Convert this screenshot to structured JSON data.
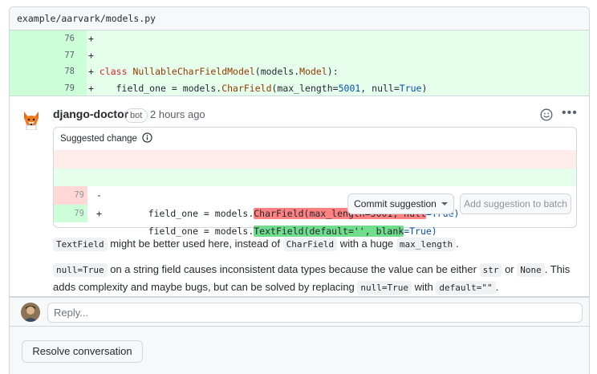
{
  "file": {
    "path": "example/aarvark/models.py"
  },
  "diff": {
    "lines": [
      {
        "num": "76",
        "sign": "+",
        "code": ""
      },
      {
        "num": "77",
        "sign": "+",
        "code": ""
      },
      {
        "num": "78",
        "sign": "+",
        "kw": "class",
        "cls_name": "NullableCharFieldModel",
        "paren_open": "(models.",
        "base": "Model",
        "paren_close": "):"
      },
      {
        "num": "79",
        "sign": "+",
        "pre": "    field_one = models.",
        "field_class": "CharField",
        "args_a": "(max_length=",
        "n": "5001",
        "args_b": ", null=",
        "val": "True",
        "close": ")"
      }
    ]
  },
  "comment": {
    "author": "django-doctor",
    "badge": "bot",
    "time": "2 hours ago",
    "suggestion": {
      "header": "Suggested change",
      "del": {
        "num": "79",
        "sign": "-",
        "pre": "    field_one = models.",
        "hl": "CharField(max_length=5001, null",
        "post": "=True)"
      },
      "add": {
        "num": "79",
        "sign": "+",
        "pre": "    field_one = models.",
        "hl": "TextField(default='', blank",
        "post": "=True)"
      },
      "commit_label": "Commit suggestion",
      "batch_label": "Add suggestion to batch"
    },
    "p1": {
      "code1": "TextField",
      "t1": " might be better used here, instead of ",
      "code2": "CharField",
      "t2": " with a huge ",
      "code3": "max_length",
      "t3": "."
    },
    "p2": {
      "code1": "null=True",
      "t1": " on a string field causes inconsistent data types because the value can be either ",
      "code2": "str",
      "t2": " or ",
      "code3": "None",
      "t3": ". This adds complexity and maybe bugs, but can be solved by replacing ",
      "code4": "null=True",
      "t4": " with ",
      "code5": "default=\"\"",
      "t5": "."
    }
  },
  "reply": {
    "placeholder": "Reply..."
  },
  "resolve": {
    "label": "Resolve conversation"
  },
  "icons": {
    "smiley": "smiley-icon",
    "info": "info-icon",
    "more": "kebab-horizontal-icon",
    "caret": "triangle-down-icon"
  }
}
